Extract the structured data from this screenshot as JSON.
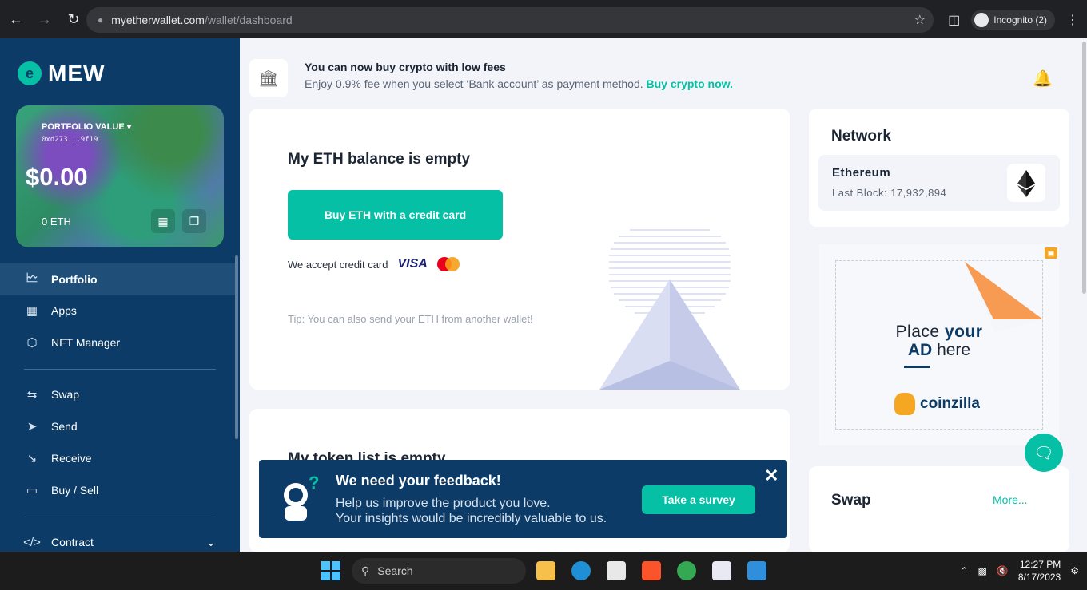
{
  "browser": {
    "url_host": "myetherwallet.com",
    "url_path": "/wallet/dashboard",
    "profile_label": "Incognito (2)"
  },
  "sidebar": {
    "logo_text": "MEW",
    "portfolio": {
      "label": "PORTFOLIO VALUE",
      "address": "0xd273...9f19",
      "value": "$0.00",
      "eth_balance": "0 ETH"
    },
    "items": [
      {
        "label": "Portfolio",
        "icon": "chart-icon"
      },
      {
        "label": "Apps",
        "icon": "grid-icon"
      },
      {
        "label": "NFT Manager",
        "icon": "nft-icon"
      },
      {
        "label": "Swap",
        "icon": "swap-icon"
      },
      {
        "label": "Send",
        "icon": "send-icon"
      },
      {
        "label": "Receive",
        "icon": "receive-icon"
      },
      {
        "label": "Buy / Sell",
        "icon": "card-icon"
      },
      {
        "label": "Contract",
        "icon": "code-icon"
      }
    ]
  },
  "banner": {
    "title": "You can now buy crypto with low fees",
    "subtitle": "Enjoy 0.9% fee when you select ‘Bank account’ as payment method.",
    "link": "Buy crypto now."
  },
  "eth_card": {
    "title": "My ETH balance is empty",
    "buy_button": "Buy ETH with a credit card",
    "accept_text": "We accept credit card",
    "visa": "VISA",
    "tip": "Tip: You can also send your ETH from another wallet!"
  },
  "token_card": {
    "title": "My token list is empty"
  },
  "network": {
    "title": "Network",
    "name": "Ethereum",
    "last_block": "Last Block: 17,932,894"
  },
  "ad": {
    "line1_a": "Place ",
    "line1_b": "your",
    "line2_a": "AD",
    "line2_b": " here",
    "brand": "coinzilla"
  },
  "swap": {
    "title": "Swap",
    "more": "More..."
  },
  "feedback": {
    "title": "We need your feedback!",
    "line1": "Help us improve the product you love.",
    "line2": "Your insights would be incredibly valuable to us.",
    "button": "Take a survey"
  },
  "taskbar": {
    "search": "Search",
    "time": "12:27 PM",
    "date": "8/17/2023"
  },
  "colors": {
    "accent": "#05c0a5",
    "sidebar": "#0b3b66"
  }
}
